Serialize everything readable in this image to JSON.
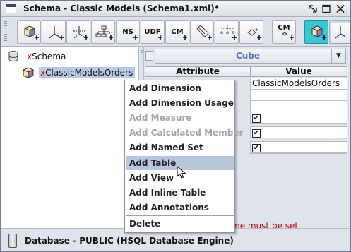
{
  "window": {
    "title": "Schema - Classic Models (Schema1.xml)*",
    "controls": [
      "restore",
      "maximize",
      "close"
    ]
  },
  "toolbar": {
    "buttons": [
      {
        "name": "add-cube",
        "icon": "cube-add-icon",
        "label": ""
      },
      {
        "name": "add-dimension",
        "icon": "dimension-add-icon",
        "label": ""
      },
      {
        "name": "add-dimension-usage",
        "icon": "dimension-usage-add-icon",
        "label": ""
      },
      {
        "name": "add-hierarchy",
        "icon": "hierarchy-add-icon",
        "label": ""
      },
      {
        "name": "add-named-set",
        "icon": "named-set-add-icon",
        "label": "NS"
      },
      {
        "name": "add-udf",
        "icon": "udf-add-icon",
        "label": "UDF"
      },
      {
        "name": "add-calculated-member",
        "icon": "calculated-member-add-icon",
        "label": "CM"
      },
      {
        "name": "add-measure",
        "icon": "measure-add-icon",
        "label": ""
      },
      {
        "name": "add-level",
        "icon": "level-add-icon",
        "label": ""
      },
      {
        "name": "add-property",
        "icon": "property-add-icon",
        "label": ""
      },
      {
        "name": "add-cube-calc-member",
        "icon": "cube-calculated-member-icon",
        "label": "CM"
      },
      {
        "name": "add-virtual-cube",
        "icon": "virtual-cube-icon",
        "label": ""
      },
      {
        "name": "add-role",
        "icon": "role-icon",
        "label": ""
      }
    ],
    "accent_color": "#35c9d8"
  },
  "tree": {
    "root": {
      "prefix": "x",
      "label": "Schema",
      "icon": "database-icon"
    },
    "child": {
      "prefix": "x",
      "label": "ClassicModelsOrders",
      "icon": "cube-icon",
      "selected": true
    }
  },
  "details": {
    "object_type": "Cube",
    "headers": {
      "attribute": "Attribute",
      "value": "Value"
    },
    "rows": [
      {
        "value": "ClassicModelsOrders"
      },
      {
        "value": ""
      },
      {
        "value": ""
      },
      {
        "value": "",
        "checkbox": true
      },
      {
        "value": "",
        "checkbox": true
      },
      {
        "value": "",
        "checkbox": true
      }
    ],
    "error_text": "me must be set"
  },
  "context_menu": {
    "items": [
      {
        "label": "Add Dimension",
        "enabled": true
      },
      {
        "label": "Add Dimension Usage",
        "enabled": true
      },
      {
        "label": "Add Measure",
        "enabled": false
      },
      {
        "label": "Add Calculated Member",
        "enabled": false
      },
      {
        "label": "Add Named Set",
        "enabled": true
      },
      {
        "label": "Add Table",
        "enabled": true,
        "highlighted": true
      },
      {
        "label": "Add View",
        "enabled": true
      },
      {
        "label": "Add Inline Table",
        "enabled": true
      },
      {
        "label": "Add Annotations",
        "enabled": true
      },
      {
        "label": "Delete",
        "enabled": true
      }
    ]
  },
  "status": {
    "text": "Database - PUBLIC (HSQL Database Engine)",
    "icon": "database-icon"
  }
}
